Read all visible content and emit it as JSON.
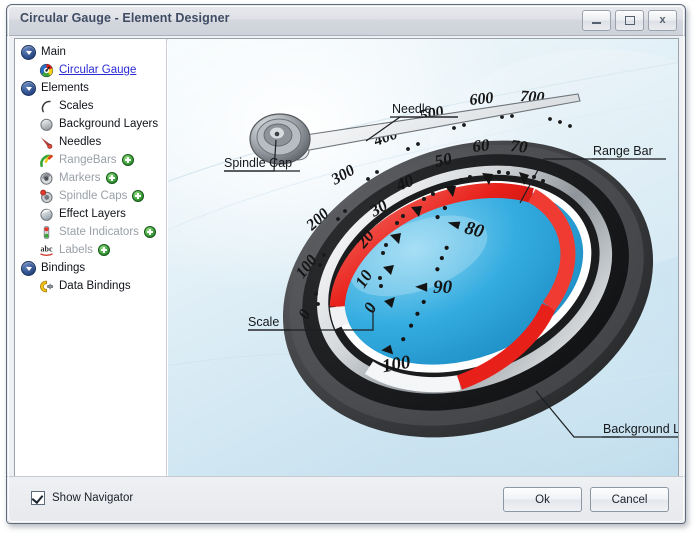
{
  "window": {
    "title": "Circular Gauge - Element Designer",
    "controls": [
      {
        "name": "minimize",
        "glyph": "minimize-icon"
      },
      {
        "name": "maximize",
        "glyph": "maximize-icon"
      },
      {
        "name": "close",
        "glyph": "close-icon",
        "label": "x"
      }
    ]
  },
  "sidebar": {
    "groups": [
      {
        "label": "Main",
        "icon": "expander-collapse-icon",
        "items": [
          {
            "label": "Circular Gauge",
            "icon": "circular-gauge-icon",
            "style": "link",
            "addable": false
          }
        ]
      },
      {
        "label": "Elements",
        "icon": "expander-collapse-icon",
        "items": [
          {
            "label": "Scales",
            "icon": "scale-arc-icon",
            "style": "normal",
            "addable": false
          },
          {
            "label": "Background Layers",
            "icon": "background-layer-icon",
            "style": "normal",
            "addable": false
          },
          {
            "label": "Needles",
            "icon": "needle-icon",
            "style": "normal",
            "addable": false
          },
          {
            "label": "RangeBars",
            "icon": "range-bar-icon",
            "style": "dim",
            "addable": true
          },
          {
            "label": "Markers",
            "icon": "marker-icon",
            "style": "dim",
            "addable": true
          },
          {
            "label": "Spindle Caps",
            "icon": "spindle-cap-icon",
            "style": "dim",
            "addable": true
          },
          {
            "label": "Effect Layers",
            "icon": "effect-layer-icon",
            "style": "normal",
            "addable": false
          },
          {
            "label": "State Indicators",
            "icon": "state-indicator-icon",
            "style": "dim",
            "addable": true
          },
          {
            "label": "Labels",
            "icon": "labels-abc-icon",
            "style": "dim",
            "addable": true
          }
        ]
      },
      {
        "label": "Bindings",
        "icon": "expander-collapse-icon",
        "items": [
          {
            "label": "Data Bindings",
            "icon": "data-bindings-icon",
            "style": "normal",
            "addable": false
          }
        ]
      }
    ]
  },
  "preview": {
    "callouts": [
      {
        "id": "needle",
        "label": "Needle"
      },
      {
        "id": "spindle-cap",
        "label": "Spindle Cap"
      },
      {
        "id": "range-bar",
        "label": "Range Bar"
      },
      {
        "id": "scale",
        "label": "Scale"
      },
      {
        "id": "background-layer",
        "label": "Background Layer"
      }
    ],
    "gauge": {
      "outer_scale_ticks": [
        "0",
        "100",
        "200",
        "300",
        "400",
        "500",
        "600",
        "700"
      ],
      "inner_scale_ticks": [
        "0",
        "10",
        "20",
        "30",
        "40",
        "50",
        "60",
        "70",
        "80",
        "90",
        "100"
      ],
      "range_bar_color": "#e8231f",
      "face_color": "#27a9e0",
      "bezel_color": "#3b3b3d"
    }
  },
  "footer": {
    "show_navigator_label": "Show Navigator",
    "show_navigator_checked": true,
    "ok_label": "Ok",
    "cancel_label": "Cancel"
  }
}
